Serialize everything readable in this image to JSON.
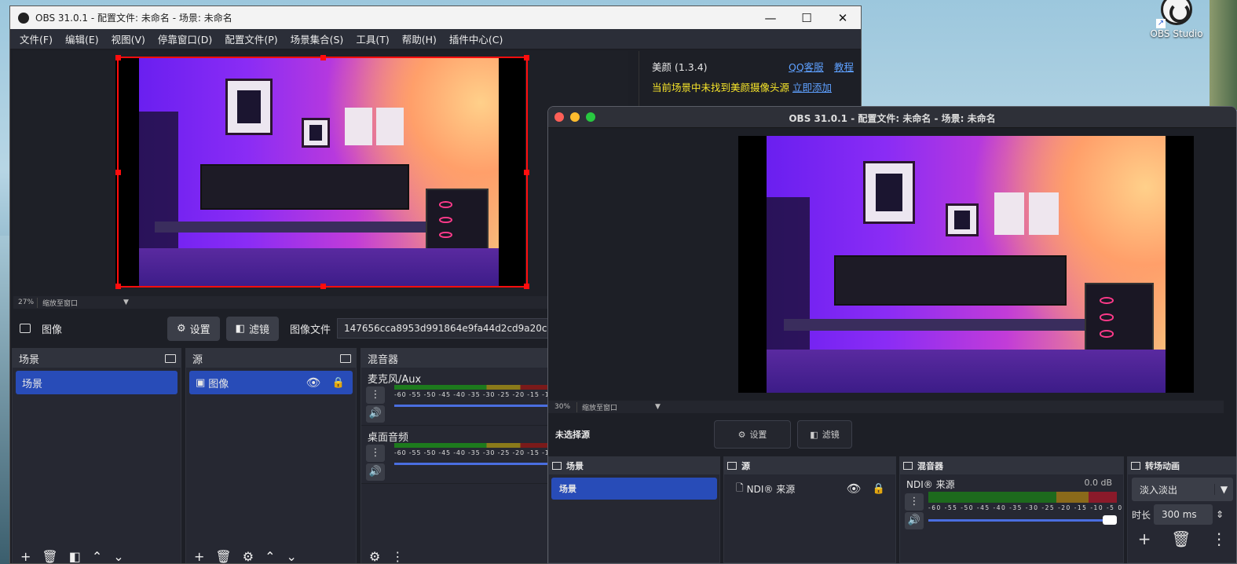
{
  "desktop": {
    "icon_label": "OBS Studio",
    "icon": "obs-icon"
  },
  "win1": {
    "title": "OBS 31.0.1 - 配置文件: 未命名 - 场景: 未命名",
    "controls": {
      "min": "—",
      "max": "☐",
      "close": "✕"
    },
    "menu": [
      "文件(F)",
      "编辑(E)",
      "视图(V)",
      "停靠窗口(D)",
      "配置文件(P)",
      "场景集合(S)",
      "工具(T)",
      "帮助(H)",
      "插件中心(C)"
    ],
    "zoom": "27%",
    "zoom_mode": "缩放至窗口",
    "plugin": {
      "name": "美颜 (1.3.4)",
      "link1": "QQ客服",
      "link2": "教程",
      "warning": "当前场景中未找到美颜摄像头源",
      "add_link": "立即添加"
    },
    "props": {
      "source_label": "图像",
      "settings": "设置",
      "filters": "滤镜",
      "file_label": "图像文件",
      "file_value": "147656cca8953d991864e9fa44d2cd9a20c"
    },
    "scenes": {
      "title": "场景",
      "items": [
        "场景"
      ]
    },
    "sources": {
      "title": "源",
      "items": [
        "图像"
      ]
    },
    "mixer": {
      "title": "混音器",
      "channels": [
        {
          "name": "麦克风/Aux",
          "ticks": "-60 -55 -50 -45 -40 -35 -30 -25 -20 -15 -1("
        },
        {
          "name": "桌面音频",
          "ticks": "-60 -55 -50 -45 -40 -35 -30 -25 -20 -15 -1("
        }
      ]
    }
  },
  "win2": {
    "title": "OBS 31.0.1 - 配置文件: 未命名 - 场景: 未命名",
    "zoom": "30%",
    "zoom_mode": "缩放至窗口",
    "props": {
      "no_source": "未选择源",
      "settings": "设置",
      "filters": "滤镜"
    },
    "scenes": {
      "title": "场景",
      "items": [
        "场景"
      ]
    },
    "sources": {
      "title": "源",
      "items": [
        "NDI® 来源"
      ]
    },
    "mixer": {
      "title": "混音器",
      "channel": "NDI® 来源",
      "db": "0.0 dB",
      "ticks": "-60 -55 -50 -45 -40 -35 -30 -25 -20 -15 -10 -5 0"
    },
    "transitions": {
      "title": "转场动画",
      "selected": "淡入淡出",
      "duration_label": "时长",
      "duration": "300 ms"
    }
  }
}
